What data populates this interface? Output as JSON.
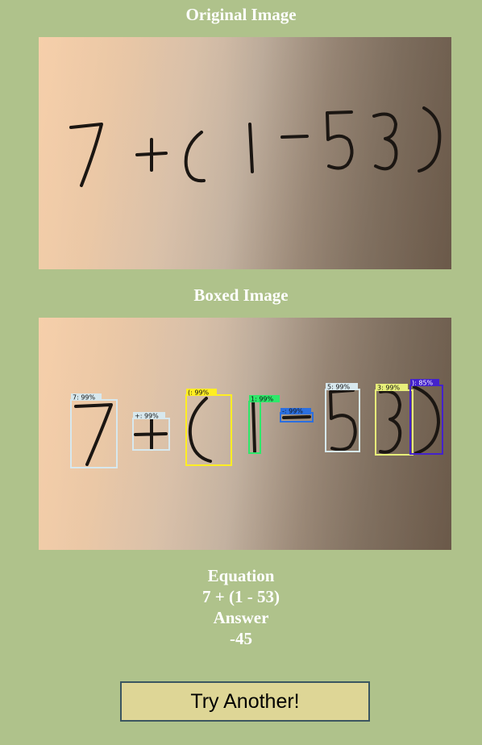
{
  "original": {
    "heading": "Original Image"
  },
  "boxed": {
    "heading": "Boxed Image",
    "detections": [
      {
        "label": "7: 99%",
        "color": "#d7e8ee"
      },
      {
        "label": "+: 99%",
        "color": "#d7e8ee"
      },
      {
        "label": "(: 99%",
        "color": "#ffee22"
      },
      {
        "label": "1: 99%",
        "color": "#2ee86a"
      },
      {
        "label": "-: 99%",
        "color": "#2b6fe0"
      },
      {
        "label": "5: 99%",
        "color": "#d7e8ee"
      },
      {
        "label": "3: 99%",
        "color": "#e8f07a"
      },
      {
        "label": "): 85%",
        "color": "#4422cc"
      }
    ]
  },
  "result": {
    "equation_label": "Equation",
    "equation": "7 + (1 - 53)",
    "answer_label": "Answer",
    "answer": "-45"
  },
  "actions": {
    "try_another": "Try Another!"
  }
}
